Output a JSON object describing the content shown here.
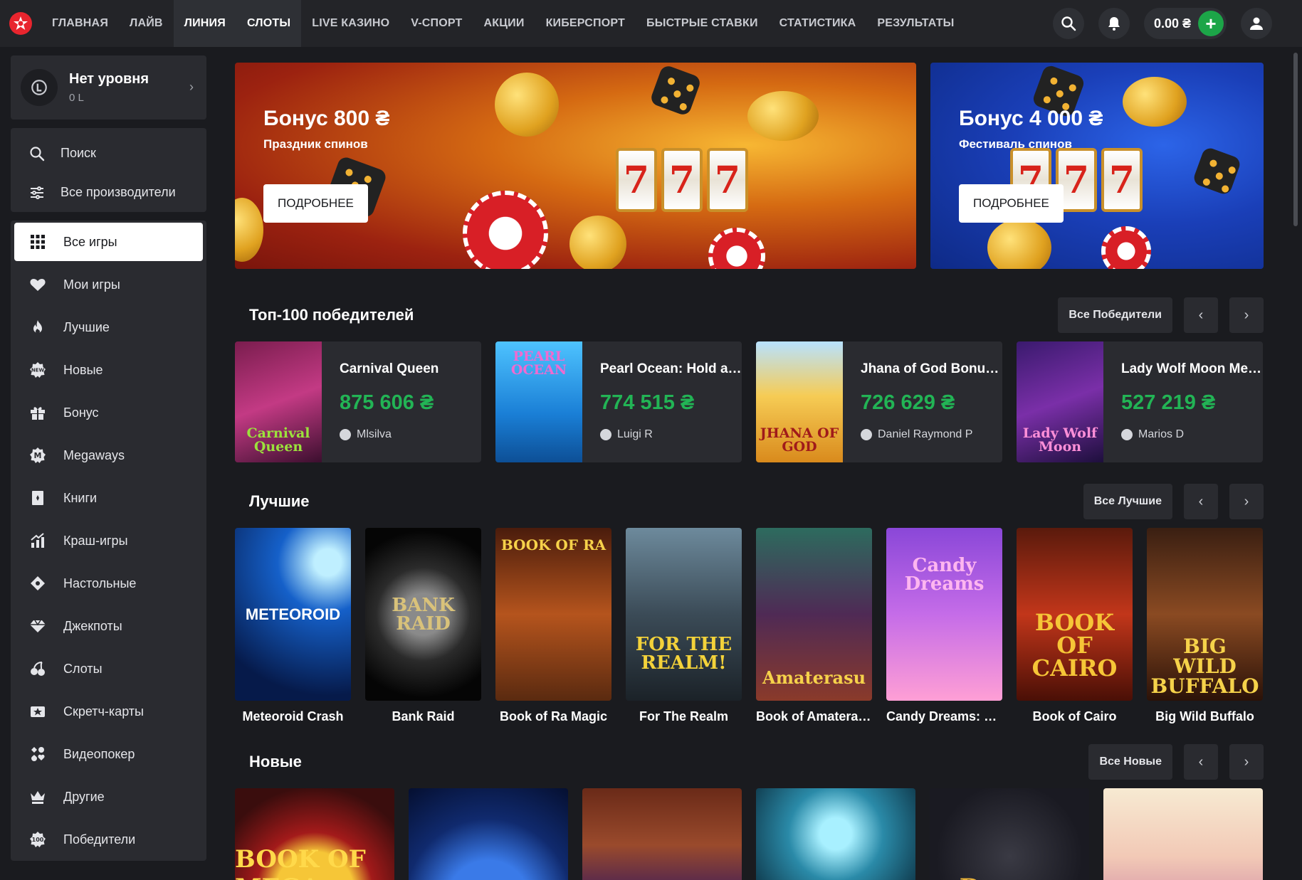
{
  "colors": {
    "accent_green": "#22b455",
    "bg": "#1a1b1f",
    "panel": "#2a2b30",
    "brand_red": "#e8252e"
  },
  "topnav": {
    "items": [
      "ГЛАВНАЯ",
      "ЛАЙВ",
      "ЛИНИЯ",
      "СЛОТЫ",
      "LIVE КАЗИНО",
      "V-СПОРТ",
      "АКЦИИ",
      "КИБЕРСПОРТ",
      "БЫСТРЫЕ СТАВКИ",
      "СТАТИСТИКА",
      "РЕЗУЛЬТАТЫ"
    ],
    "balance": "0.00 ₴",
    "plus": "+"
  },
  "sidebar": {
    "level_title": "Нет уровня",
    "level_sub": "0 L",
    "search": "Поиск",
    "providers": "Все производители",
    "categories": [
      {
        "label": "Все игры",
        "icon": "grid-icon"
      },
      {
        "label": "Мои игры",
        "icon": "heart-icon"
      },
      {
        "label": "Лучшие",
        "icon": "flame-icon"
      },
      {
        "label": "Новые",
        "icon": "new-badge-icon"
      },
      {
        "label": "Бонус",
        "icon": "gift-icon"
      },
      {
        "label": "Megaways",
        "icon": "megaways-icon"
      },
      {
        "label": "Книги",
        "icon": "book-icon"
      },
      {
        "label": "Краш-игры",
        "icon": "chart-icon"
      },
      {
        "label": "Настольные",
        "icon": "table-game-icon"
      },
      {
        "label": "Джекпоты",
        "icon": "diamond-icon"
      },
      {
        "label": "Слоты",
        "icon": "cherries-icon"
      },
      {
        "label": "Скретч-карты",
        "icon": "scratch-card-icon"
      },
      {
        "label": "Видеопокер",
        "icon": "poker-icon"
      },
      {
        "label": "Другие",
        "icon": "crown-icon"
      },
      {
        "label": "Победители",
        "icon": "winners-icon"
      }
    ]
  },
  "banners": [
    {
      "title": "Бонус 800 ₴",
      "subtitle": "Праздник спинов",
      "button": "ПОДРОБНЕЕ",
      "reels": [
        "7",
        "7",
        "7"
      ]
    },
    {
      "title": "Бонус 4 000 ₴",
      "subtitle": "Фестиваль спинов",
      "button": "ПОДРОБНЕЕ",
      "reels": [
        "7",
        "7",
        "7"
      ]
    }
  ],
  "winners_section": {
    "title": "Топ-100 победителей",
    "all_label": "Все Победители",
    "prev": "‹",
    "next": "›",
    "items": [
      {
        "game": "Carnival Queen",
        "amount": "875 606 ₴",
        "user": "Mlsilva",
        "thumb_text": "Carnival Queen"
      },
      {
        "game": "Pearl Ocean: Hold and Win",
        "amount": "774 515 ₴",
        "user": "Luigi R",
        "thumb_text": "PEARL OCEAN"
      },
      {
        "game": "Jhana of God Bonus Buy",
        "amount": "726 629 ₴",
        "user": "Daniel Raymond P",
        "thumb_text": "JHANA OF GOD"
      },
      {
        "game": "Lady Wolf Moon Megaways",
        "amount": "527 219 ₴",
        "user": "Marios D",
        "thumb_text": "Lady Wolf Moon"
      }
    ]
  },
  "best_section": {
    "title": "Лучшие",
    "all_label": "Все Лучшие",
    "prev": "‹",
    "next": "›",
    "games": [
      {
        "title": "Meteoroid Crash",
        "thumb_text": "METEOROID"
      },
      {
        "title": "Bank Raid",
        "thumb_text": "BANK RAID"
      },
      {
        "title": "Book of Ra Magic",
        "thumb_text": "BOOK OF RA"
      },
      {
        "title": "For The Realm",
        "thumb_text": "FOR THE REALM!"
      },
      {
        "title": "Book of Amaterasu",
        "thumb_text": "Amaterasu"
      },
      {
        "title": "Candy Dreams: Sweet Planet",
        "thumb_text": "Candy Dreams"
      },
      {
        "title": "Book of Cairo",
        "thumb_text": "BOOK OF CAIRO"
      },
      {
        "title": "Big Wild Buffalo",
        "thumb_text": "BIG WILD BUFFALO"
      }
    ]
  },
  "new_section": {
    "title": "Новые",
    "all_label": "Все Новые",
    "prev": "‹",
    "next": "›",
    "games": [
      {
        "thumb_text": "BOOK OF MEGA"
      },
      {
        "thumb_text": ""
      },
      {
        "thumb_text": ""
      },
      {
        "thumb_text": ""
      },
      {
        "thumb_text": "Dragon"
      },
      {
        "thumb_text": ""
      }
    ]
  }
}
